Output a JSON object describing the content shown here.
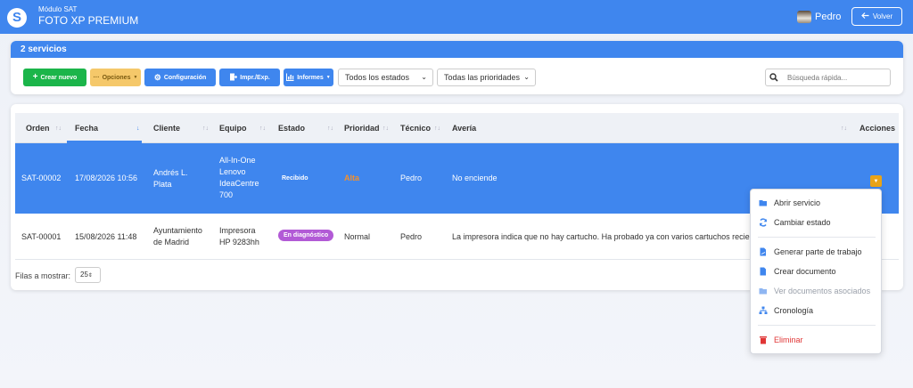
{
  "header": {
    "logo_letter": "S",
    "module_label": "Módulo SAT",
    "app_title": "FOTO XP PREMIUM",
    "user_name": "Pedro",
    "back_label": "Volver"
  },
  "summary": {
    "title": "2 servicios"
  },
  "toolbar": {
    "new_label": "Crear nuevo",
    "options_label": "Opciones",
    "config_label": "Configuración",
    "print_label": "Impr./Exp.",
    "reports_label": "Informes",
    "status_filter": "Todos los estados",
    "priority_filter": "Todas las prioridades",
    "search_placeholder": "Búsqueda rápida..."
  },
  "table": {
    "columns": [
      "Orden",
      "Fecha",
      "Cliente",
      "Equipo",
      "Estado",
      "Prioridad",
      "Técnico",
      "Avería",
      "Acciones"
    ],
    "rows": [
      {
        "orden": "SAT-00002",
        "fecha": "17/08/2026 10:56",
        "cliente_1": "Andrés L.",
        "cliente_2": "Plata",
        "equipo_1": "All-In-One",
        "equipo_2": "Lenovo",
        "equipo_3": "IdeaCentre",
        "equipo_4": "700",
        "estado": "Recibido",
        "prioridad": "Alta",
        "tecnico": "Pedro",
        "averia": "No enciende"
      },
      {
        "orden": "SAT-00001",
        "fecha": "15/08/2026 11:48",
        "cliente_1": "Ayuntamiento",
        "cliente_2": "de Madrid",
        "equipo_1": "Impresora",
        "equipo_2": "HP 9283hh",
        "estado": "En diagnóstico",
        "prioridad": "Normal",
        "tecnico": "Pedro",
        "averia": "La impresora indica que no hay cartucho. Ha probado ya con varios cartuchos recie"
      }
    ]
  },
  "pagination": {
    "label": "Filas a mostrar:",
    "value": "25"
  },
  "actions_menu": {
    "items": [
      {
        "label": "Abrir servicio",
        "icon": "folder-open-icon"
      },
      {
        "label": "Cambiar estado",
        "icon": "sync-icon"
      },
      {
        "label": "Generar parte de trabajo",
        "icon": "file-signature-icon"
      },
      {
        "label": "Crear documento",
        "icon": "file-icon"
      },
      {
        "label": "Ver documentos asociados",
        "icon": "folder-open-icon",
        "disabled": true
      },
      {
        "label": "Cronología",
        "icon": "sitemap-icon"
      },
      {
        "label": "Eliminar",
        "icon": "trash-icon",
        "danger": true
      }
    ]
  },
  "colors": {
    "primary": "#3f86ee",
    "success": "#1bb54a",
    "warning": "#f5c86a",
    "priority_high": "#f5902a",
    "badge_diagnostico": "#b25ad6",
    "danger": "#e03535"
  }
}
